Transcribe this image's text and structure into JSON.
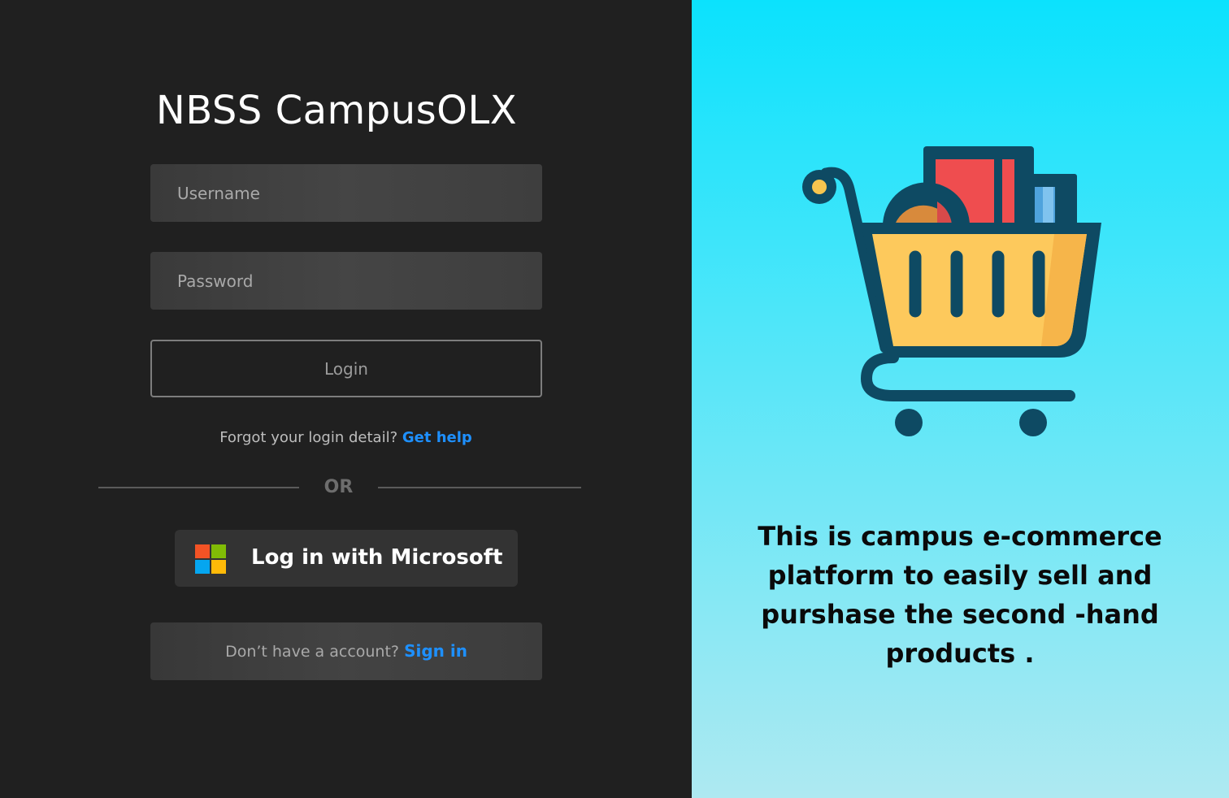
{
  "app": {
    "title": "NBSS CampusOLX"
  },
  "login_form": {
    "username_placeholder": "Username",
    "password_placeholder": "Password",
    "login_label": "Login"
  },
  "help": {
    "prompt": "Forgot your login detail?",
    "link_label": "Get help"
  },
  "divider": {
    "label": "OR"
  },
  "microsoft": {
    "label": "Log in with Microsoft",
    "icon": "microsoft-logo-icon"
  },
  "signup": {
    "prompt": "Don’t have a account?",
    "link_label": "Sign in"
  },
  "promo": {
    "illustration": "shopping-cart-icon",
    "tagline": "This is  campus e-commerce platform to easily sell and purshase the second -hand products ."
  },
  "colors": {
    "left_bg": "#202020",
    "accent_link": "#1e90ff",
    "right_bg_top": "#0be2fd",
    "right_bg_bottom": "#aee9f1"
  }
}
